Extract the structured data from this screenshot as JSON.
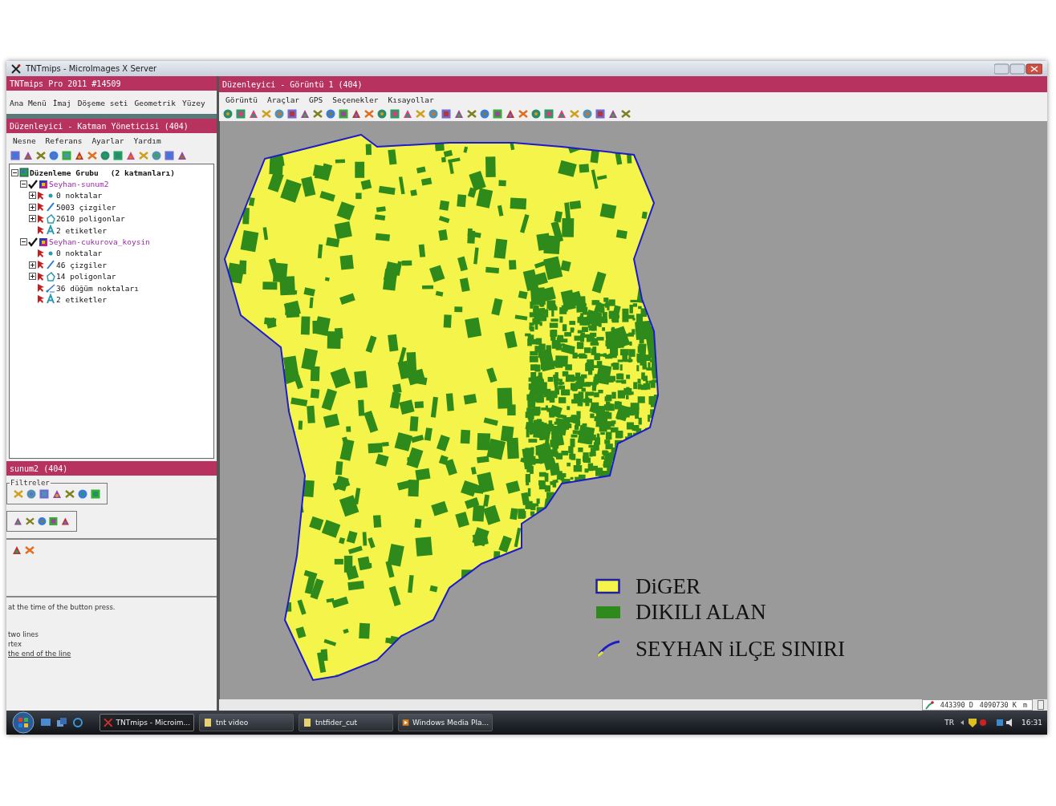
{
  "screen_title": "TNTmips - MicroImages X Server",
  "main_window": {
    "title": "TNTmips Pro 2011   #14509",
    "menu": [
      "Ana Menü",
      "İmaj",
      "Döşeme seti",
      "Geometrik",
      "Yüzey"
    ]
  },
  "layer_manager": {
    "title": "Düzenleyici - Katman Yöneticisi (404)",
    "menu": [
      "Nesne",
      "Referans",
      "Ayarlar",
      "Yardım"
    ],
    "tree": {
      "label": "Düzenleme Grubu",
      "count": "(2 katmanları)",
      "expanded": true,
      "children": [
        {
          "label": "Seyhan-sunum2",
          "expanded": true,
          "checked": true,
          "children": [
            {
              "kind": "point",
              "label": "0 noktalar",
              "expanded": false
            },
            {
              "kind": "line",
              "label": "5003 çizgiler",
              "expanded": false
            },
            {
              "kind": "polygon",
              "label": "2610 poligonlar",
              "expanded": false
            },
            {
              "kind": "label",
              "label": "2 etiketler"
            }
          ]
        },
        {
          "label": "Seyhan-cukurova_koysin",
          "expanded": true,
          "checked": true,
          "children": [
            {
              "kind": "point",
              "label": "0 noktalar"
            },
            {
              "kind": "line",
              "label": "46 çizgiler",
              "expanded": false
            },
            {
              "kind": "polygon",
              "label": "14 poligonlar",
              "expanded": false
            },
            {
              "kind": "node",
              "label": "36 düğüm noktaları"
            },
            {
              "kind": "label",
              "label": "2 etiketler"
            }
          ]
        }
      ]
    }
  },
  "editor_panel": {
    "title": "sunum2 (404)",
    "filter_label": "Filtreler",
    "help_lines": [
      "at the time of the button press.",
      "two lines",
      "rtex",
      "the end of the line"
    ]
  },
  "view": {
    "title": "Düzenleyici - Görüntü 1 (404)",
    "menu": [
      "Görüntü",
      "Araçlar",
      "GPS",
      "Seçenekler",
      "Kısayollar"
    ],
    "legend": [
      {
        "kind": "fill",
        "label": "DiGER",
        "color": "#f4f44a"
      },
      {
        "kind": "fill",
        "label": "DIKILI ALAN",
        "color": "#2f8a1c"
      },
      {
        "kind": "line",
        "label": "SEYHAN iLÇE SINIRI",
        "color": "#1c1cc8"
      }
    ],
    "status": {
      "easting": "443390 D",
      "northing": "4090730 K",
      "unit": "m"
    }
  },
  "taskbar": {
    "buttons": [
      {
        "label": "TNTmips - Microim...",
        "selected": true
      },
      {
        "label": "tnt video",
        "selected": false
      },
      {
        "label": "tntfider_cut",
        "selected": false
      },
      {
        "label": "Windows Media Pla...",
        "selected": false
      }
    ],
    "language": "TR",
    "clock": "16:31"
  }
}
